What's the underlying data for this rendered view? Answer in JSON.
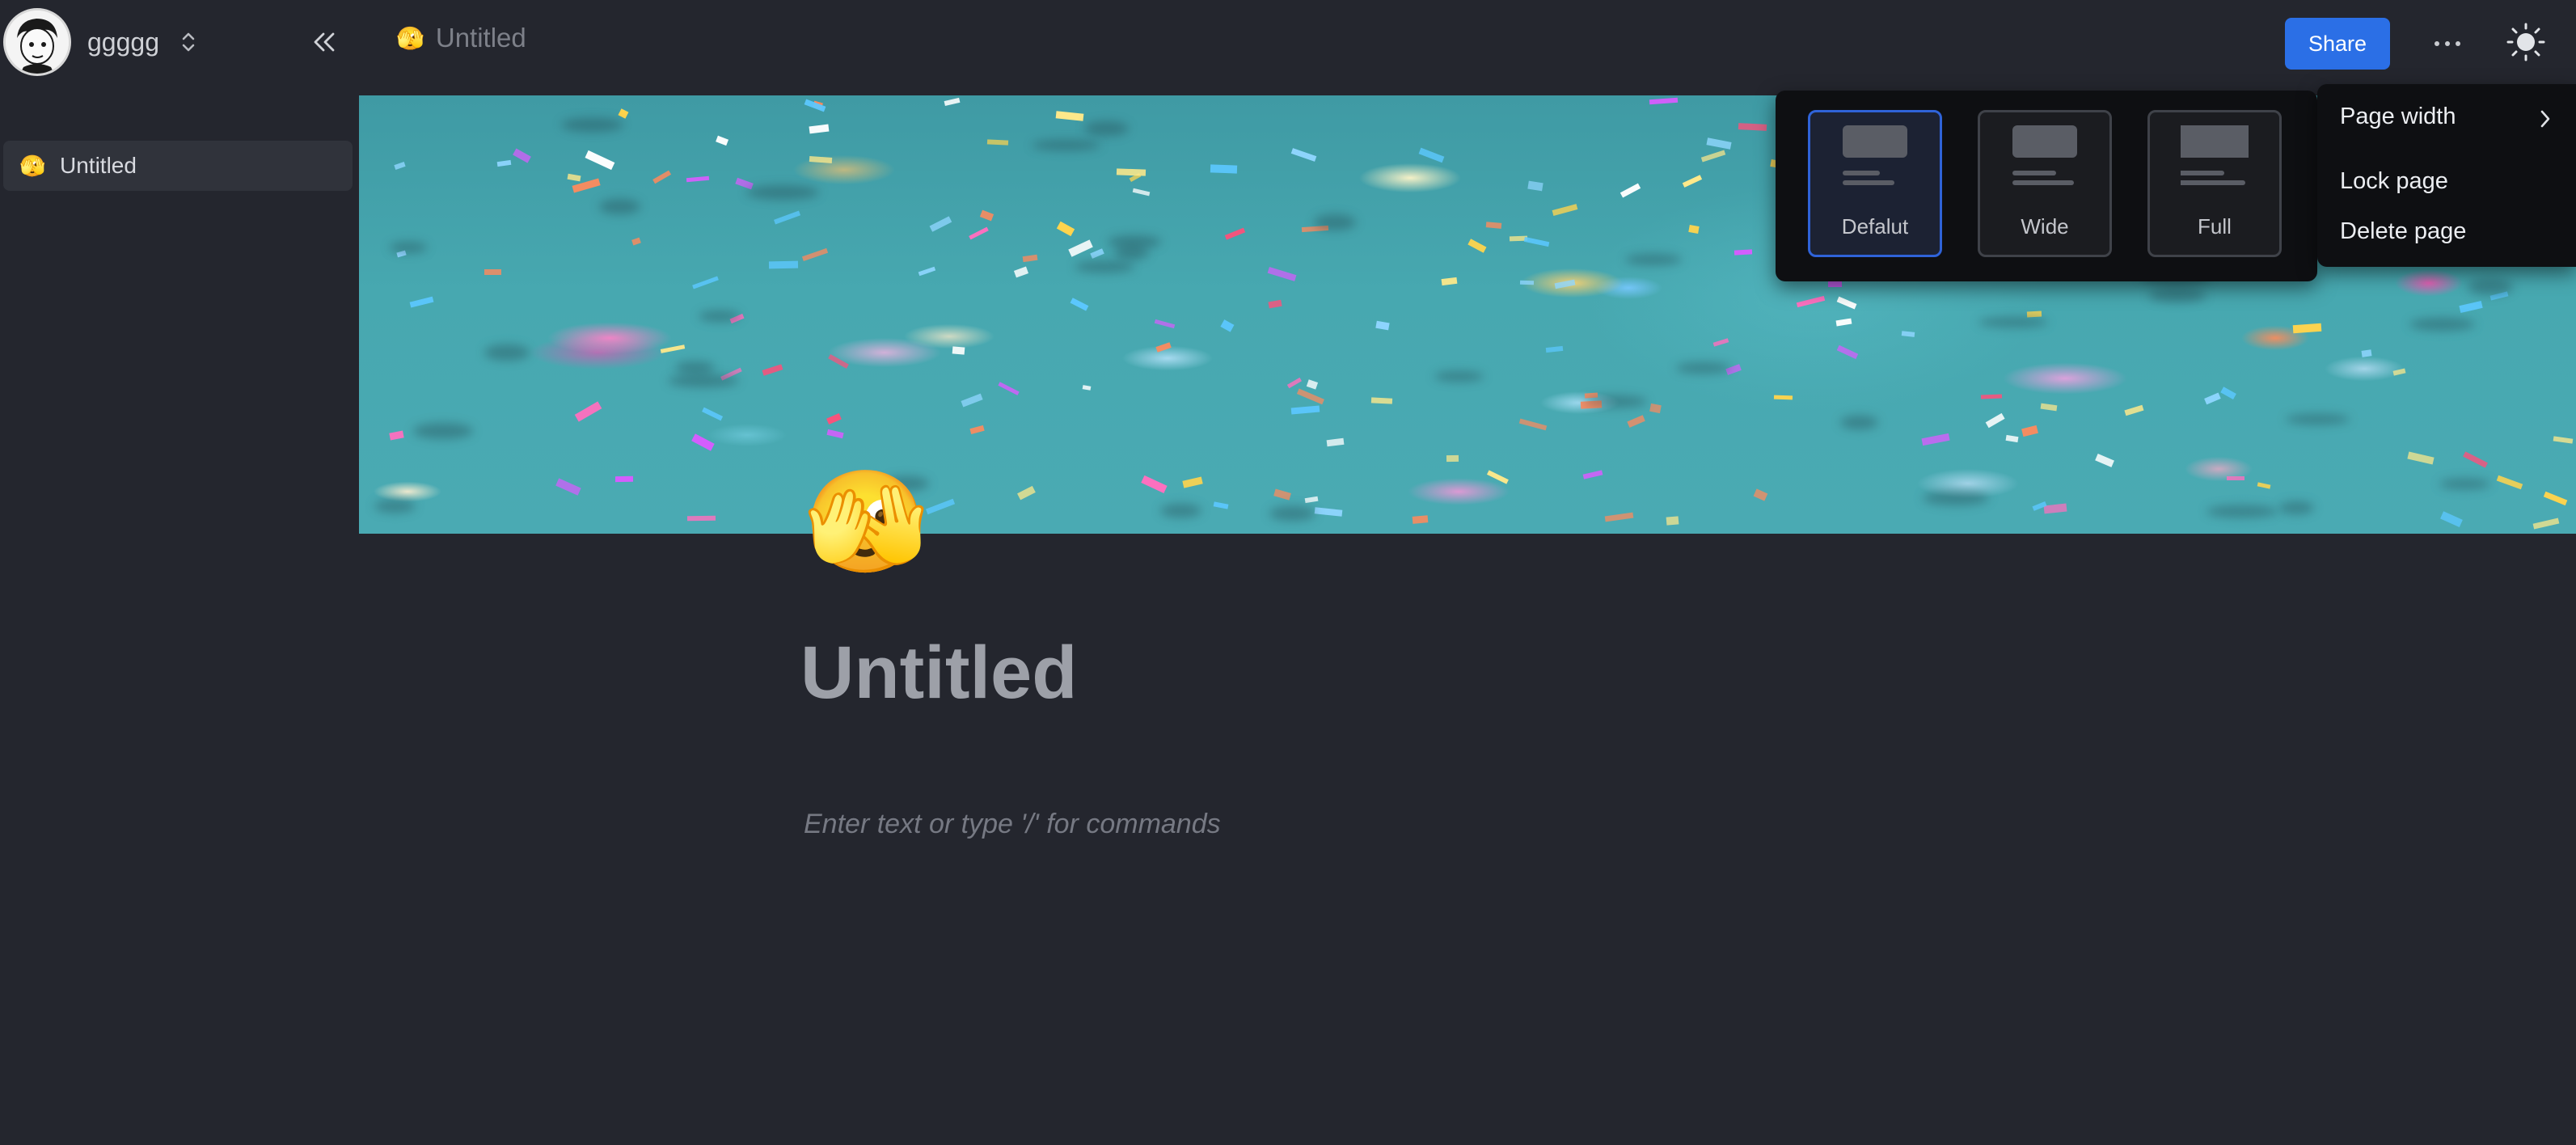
{
  "workspace": {
    "name": "ggggg"
  },
  "sidebar": {
    "items": [
      {
        "emoji": "🫣",
        "label": "Untitled"
      }
    ]
  },
  "header": {
    "breadcrumb": {
      "emoji": "🫣",
      "label": "Untitled"
    },
    "share_label": "Share"
  },
  "page": {
    "emoji": "🫣",
    "title": "Untitled",
    "placeholder": "Enter text or type '/' for commands"
  },
  "width_options": [
    {
      "label": "Defalut",
      "selected": true
    },
    {
      "label": "Wide",
      "selected": false
    },
    {
      "label": "Full",
      "selected": false
    }
  ],
  "menu": {
    "page_width": "Page width",
    "lock_page": "Lock page",
    "delete_page": "Delete page"
  },
  "colors": {
    "background": "#24262e",
    "accent": "#2b6fe6",
    "selected_border": "#2f63d8",
    "popover": "#0e0f12"
  },
  "icons": [
    "workspace-avatar",
    "chevron-up-down-icon",
    "double-chevron-left-icon",
    "more-horizontal-icon",
    "theme-sun-icon",
    "chevron-right-icon"
  ]
}
